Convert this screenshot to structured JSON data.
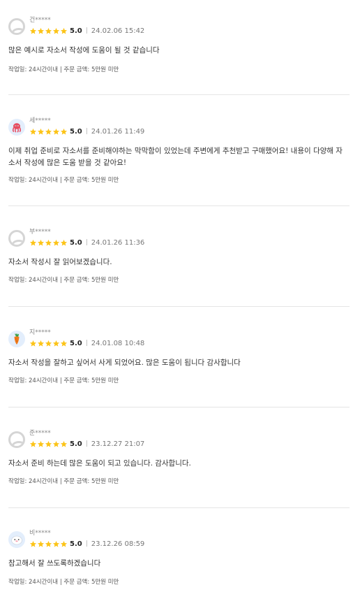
{
  "reviews": [
    {
      "nickname": "건*****",
      "avatar": "default-avatar",
      "rating": "5.0",
      "date": "24.02.06 15:42",
      "content": "많은 예시로 자소서 작성에 도움이 될 것 같습니다",
      "meta": "작업일: 24시간이내 | 주문 금액: 5만원 미만"
    },
    {
      "nickname": "세*****",
      "avatar": "octopus-avatar",
      "rating": "5.0",
      "date": "24.01.26 11:49",
      "content": "이제 취업 준비로 자소서를 준비해야하는 막막함이 있었는데 주변에게 추천받고 구매했어요! 내용이 다양해 자소서 작성에 많은 도움 받을 것 같아요!",
      "meta": "작업일: 24시간이내 | 주문 금액: 5만원 미만"
    },
    {
      "nickname": "부*****",
      "avatar": "default-avatar",
      "rating": "5.0",
      "date": "24.01.26 11:36",
      "content": "자소서 작성시 잘 읽어보겠습니다.",
      "meta": "작업일: 24시간이내 | 주문 금액: 5만원 미만"
    },
    {
      "nickname": "지*****",
      "avatar": "carrot-avatar",
      "rating": "5.0",
      "date": "24.01.08 10:48",
      "content": "자소서 작성을 잘하고 싶어서 사게 되었어요. 많은 도움이 됩니다 감사합니다",
      "meta": "작업일: 24시간이내 | 주문 금액: 5만원 미만"
    },
    {
      "nickname": "준*****",
      "avatar": "default-avatar",
      "rating": "5.0",
      "date": "23.12.27 21:07",
      "content": "자소서 준비 하는데 많은 도움이 되고 있습니다. 감사합니다.",
      "meta": "작업일: 24시간이내 | 주문 금액: 5만원 미만"
    },
    {
      "nickname": "비*****",
      "avatar": "ghost-avatar",
      "rating": "5.0",
      "date": "23.12.26 08:59",
      "content": "참고해서 잘 쓰도록하겠습니다",
      "meta": "작업일: 24시간이내 | 주문 금액: 5만원 미만"
    }
  ],
  "colors": {
    "star": "#fcc419",
    "divider": "#e5e5e5"
  }
}
